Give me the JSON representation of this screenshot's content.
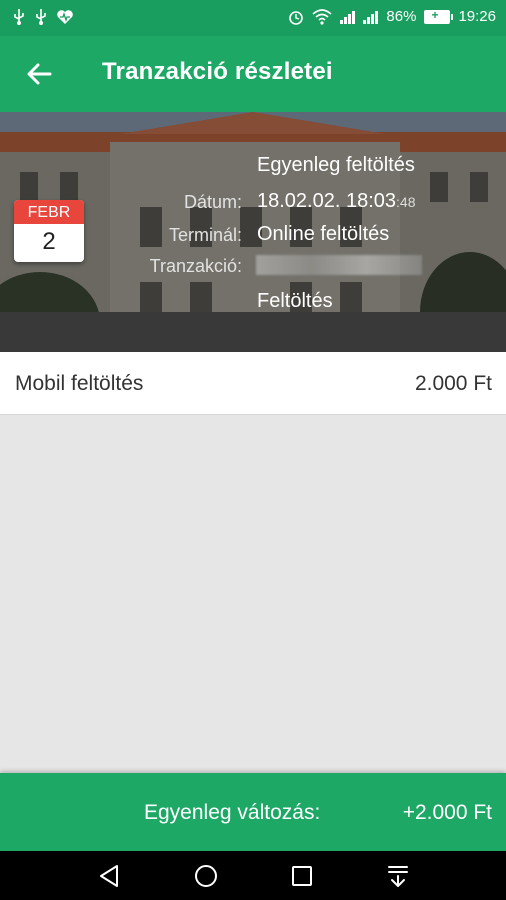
{
  "status_bar": {
    "battery_percent": "86%",
    "time": "19:26",
    "left_icons": [
      "usb-icon",
      "usb-icon",
      "heart-icon"
    ],
    "right_icons": [
      "alarm-icon",
      "wifi-icon",
      "signal-icon",
      "signal-icon",
      "battery-icon"
    ]
  },
  "app_bar": {
    "title": "Tranzakció részletei",
    "back_icon": "arrow-left-icon"
  },
  "transaction": {
    "calendar": {
      "month": "FEBR",
      "day": "2"
    },
    "type": "Egyenleg feltöltés",
    "date_label": "Dátum:",
    "date_value": "18.02.02.  18:03",
    "date_seconds": ":48",
    "terminal_label": "Terminál:",
    "terminal_value": "Online feltöltés",
    "transaction_label": "Tranzakció:",
    "category": "Feltöltés"
  },
  "items": [
    {
      "name": "Mobil feltöltés",
      "amount": "2.000 Ft"
    }
  ],
  "footer": {
    "label": "Egyenleg változás:",
    "value": "+2.000 Ft"
  },
  "nav_bar": {
    "icons": [
      "back-triangle-icon",
      "home-circle-icon",
      "recents-square-icon",
      "notification-pull-icon"
    ]
  },
  "colors": {
    "primary": "#1ea866",
    "status_bar": "#1a9e5f",
    "calendar_accent": "#e8453c"
  }
}
